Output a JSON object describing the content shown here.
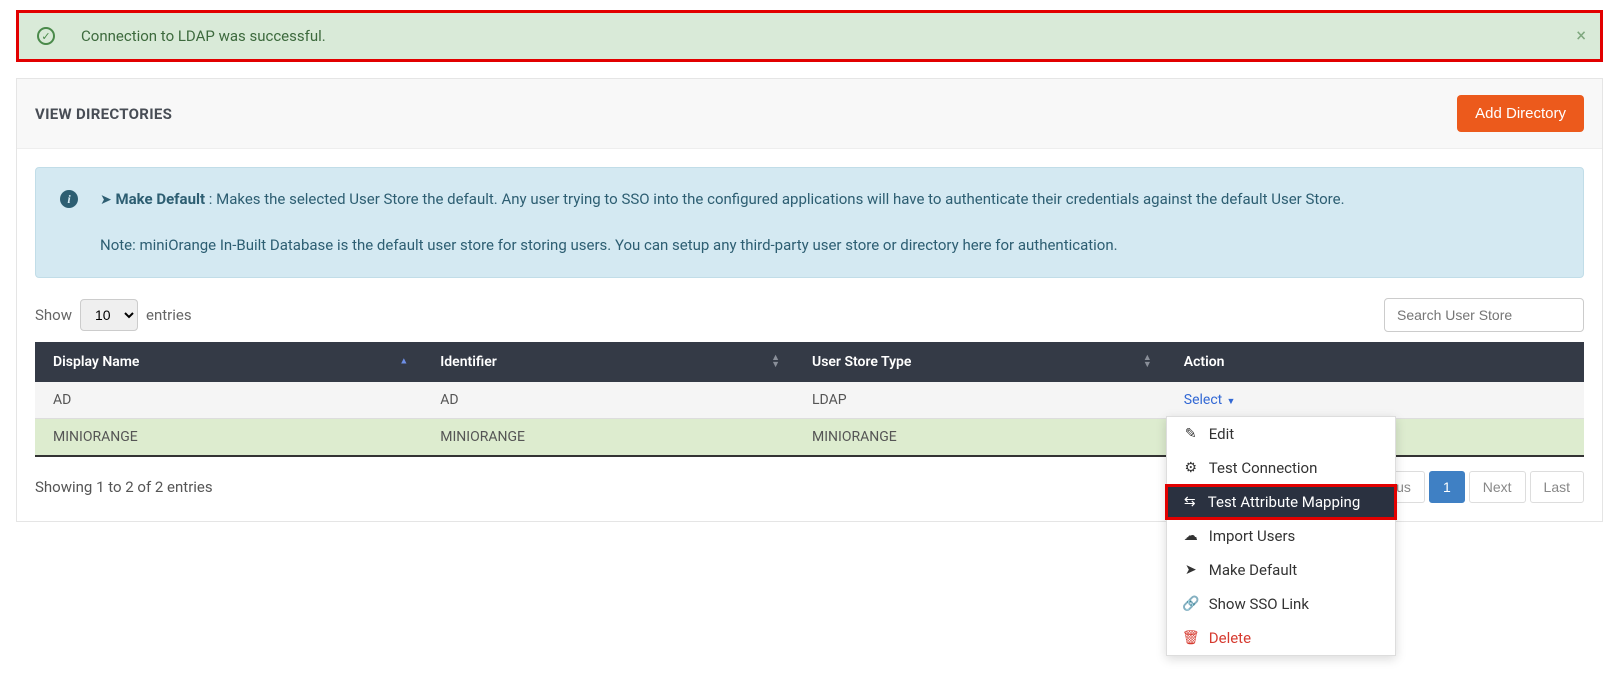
{
  "alert": {
    "message": "Connection to LDAP was successful."
  },
  "panel": {
    "title": "VIEW DIRECTORIES",
    "add_button": "Add Directory"
  },
  "info": {
    "default_label": "Make Default",
    "default_desc": ": Makes the selected User Store the default. Any user trying to SSO into the configured applications will have to authenticate their credentials against the default User Store.",
    "note": "Note: miniOrange In-Built Database is the default user store for storing users. You can setup any third-party user store or directory here for authentication."
  },
  "controls": {
    "show_label": "Show",
    "entries_label": "entries",
    "entries_value": "10",
    "search_placeholder": "Search User Store"
  },
  "table": {
    "headers": {
      "display_name": "Display Name",
      "identifier": "Identifier",
      "user_store_type": "User Store Type",
      "action": "Action"
    },
    "rows": [
      {
        "display_name": "AD",
        "identifier": "AD",
        "user_store_type": "LDAP",
        "action": "Select"
      },
      {
        "display_name": "MINIORANGE",
        "identifier": "MINIORANGE",
        "user_store_type": "MINIORANGE",
        "action": ""
      }
    ]
  },
  "dropdown": {
    "edit": "Edit",
    "test_connection": "Test Connection",
    "test_attribute_mapping": "Test Attribute Mapping",
    "import_users": "Import Users",
    "make_default": "Make Default",
    "show_sso_link": "Show SSO Link",
    "delete": "Delete"
  },
  "footer": {
    "info": "Showing 1 to 2 of 2 entries",
    "page_partial": "us",
    "page_1": "1",
    "next": "Next",
    "last": "Last"
  }
}
